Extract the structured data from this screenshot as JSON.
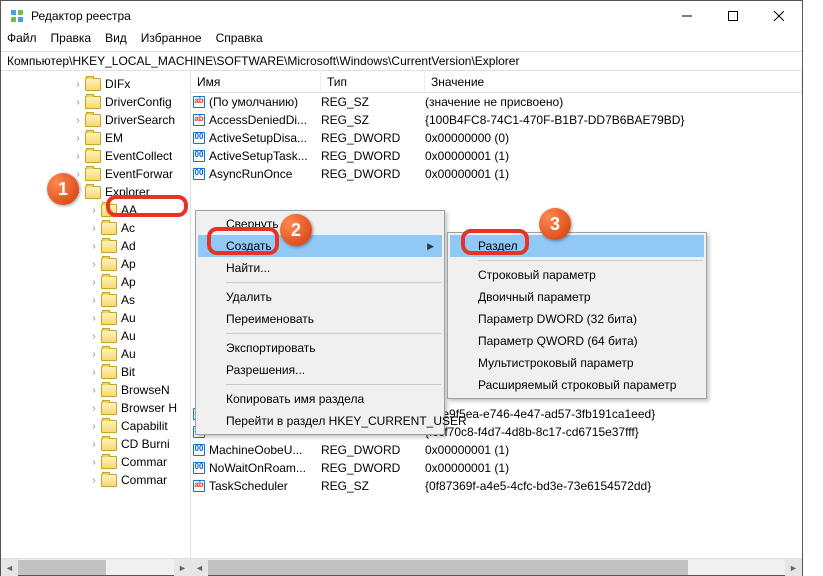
{
  "title": "Редактор реестра",
  "menu": {
    "file": "Файл",
    "edit": "Правка",
    "view": "Вид",
    "favorites": "Избранное",
    "help": "Справка"
  },
  "address": "Компьютер\\HKEY_LOCAL_MACHINE\\SOFTWARE\\Microsoft\\Windows\\CurrentVersion\\Explorer",
  "tree": [
    "DIFx",
    "DriverConfig",
    "DriverSearch",
    "EM",
    "EventCollect",
    "EventForwar",
    "Explorer",
    "AA",
    "Ac",
    "Ad",
    "Ap",
    "Ap",
    "As",
    "Au",
    "Au",
    "Au",
    "Bit",
    "BrowseN",
    "Browser H",
    "Capabilit",
    "CD Burni",
    "Commar",
    "Commar"
  ],
  "listhead": {
    "name": "Имя",
    "type": "Тип",
    "value": "Значение"
  },
  "rows": [
    {
      "i": "str",
      "n": "(По умолчанию)",
      "t": "REG_SZ",
      "v": "(значение не присвоено)"
    },
    {
      "i": "str",
      "n": "AccessDeniedDi...",
      "t": "REG_SZ",
      "v": "{100B4FC8-74C1-470F-B1B7-DD7B6BAE79BD}"
    },
    {
      "i": "bin",
      "n": "ActiveSetupDisa...",
      "t": "REG_DWORD",
      "v": "0x00000000 (0)"
    },
    {
      "i": "bin",
      "n": "ActiveSetupTask...",
      "t": "REG_DWORD",
      "v": "0x00000001 (1)"
    },
    {
      "i": "bin",
      "n": "AsyncRunOnce",
      "t": "REG_DWORD",
      "v": "0x00000001 (1)"
    }
  ],
  "rows_after": [
    {
      "i": "str",
      "n": "",
      "t": "",
      "v": "{8be9f5ea-e746-4e47-ad57-3fb191ca1eed}"
    },
    {
      "i": "str",
      "n": "",
      "t": "",
      "v": "{fccf70c8-f4d7-4d8b-8c17-cd6715e37fff}"
    },
    {
      "i": "bin",
      "n": "MachineOobeU...",
      "t": "REG_DWORD",
      "v": "0x00000001 (1)"
    },
    {
      "i": "bin",
      "n": "NoWaitOnRoam...",
      "t": "REG_DWORD",
      "v": "0x00000001 (1)"
    },
    {
      "i": "str",
      "n": "TaskScheduler",
      "t": "REG_SZ",
      "v": "{0f87369f-a4e5-4cfc-bd3e-73e6154572dd}"
    }
  ],
  "ctx1": {
    "collapse": "Свернуть",
    "create": "Создать",
    "find": "Найти...",
    "delete": "Удалить",
    "rename": "Переименовать",
    "export": "Экспортировать",
    "perms": "Разрешения...",
    "copykey": "Копировать имя раздела",
    "goto": "Перейти в раздел HKEY_CURRENT_USER"
  },
  "ctx2": {
    "key": "Раздел",
    "string": "Строковый параметр",
    "binary": "Двоичный параметр",
    "dword": "Параметр DWORD (32 бита)",
    "qword": "Параметр QWORD (64 бита)",
    "multistring": "Мультистроковый параметр",
    "expandstring": "Расширяемый строковый параметр"
  }
}
